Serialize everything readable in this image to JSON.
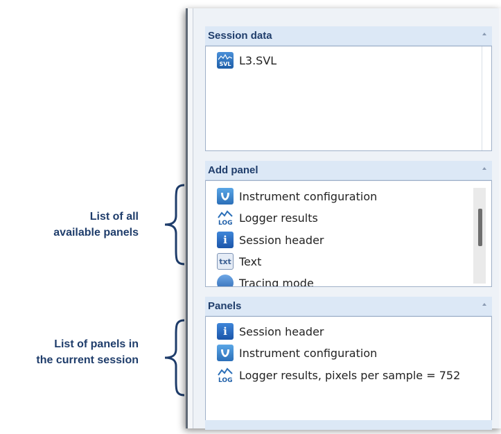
{
  "annotations": {
    "available": {
      "line1": "List of all",
      "line2": "available panels"
    },
    "current": {
      "line1": "List of panels in",
      "line2": "the current session"
    }
  },
  "session_data": {
    "title": "Session data",
    "items": [
      {
        "label": "L3.SVL",
        "icon": "svl-file-icon"
      }
    ]
  },
  "add_panel": {
    "title": "Add panel",
    "items": [
      {
        "label": "Instrument configuration",
        "icon": "instrument-config-icon"
      },
      {
        "label": "Logger results",
        "icon": "logger-icon"
      },
      {
        "label": "Session header",
        "icon": "info-icon"
      },
      {
        "label": "Text",
        "icon": "text-icon"
      },
      {
        "label": "Tracing mode",
        "icon": "round-icon"
      }
    ]
  },
  "panels": {
    "title": "Panels",
    "items": [
      {
        "label": "Session header",
        "icon": "info-icon"
      },
      {
        "label": "Instrument configuration",
        "icon": "instrument-config-icon"
      },
      {
        "label": "Logger results, pixels per sample = 752",
        "icon": "logger-icon"
      }
    ]
  },
  "colors": {
    "header_bg": "#dce8f6",
    "title_text": "#1f3d6b",
    "border": "#9fb0c8",
    "icon_blue": "#1d5ea8"
  }
}
